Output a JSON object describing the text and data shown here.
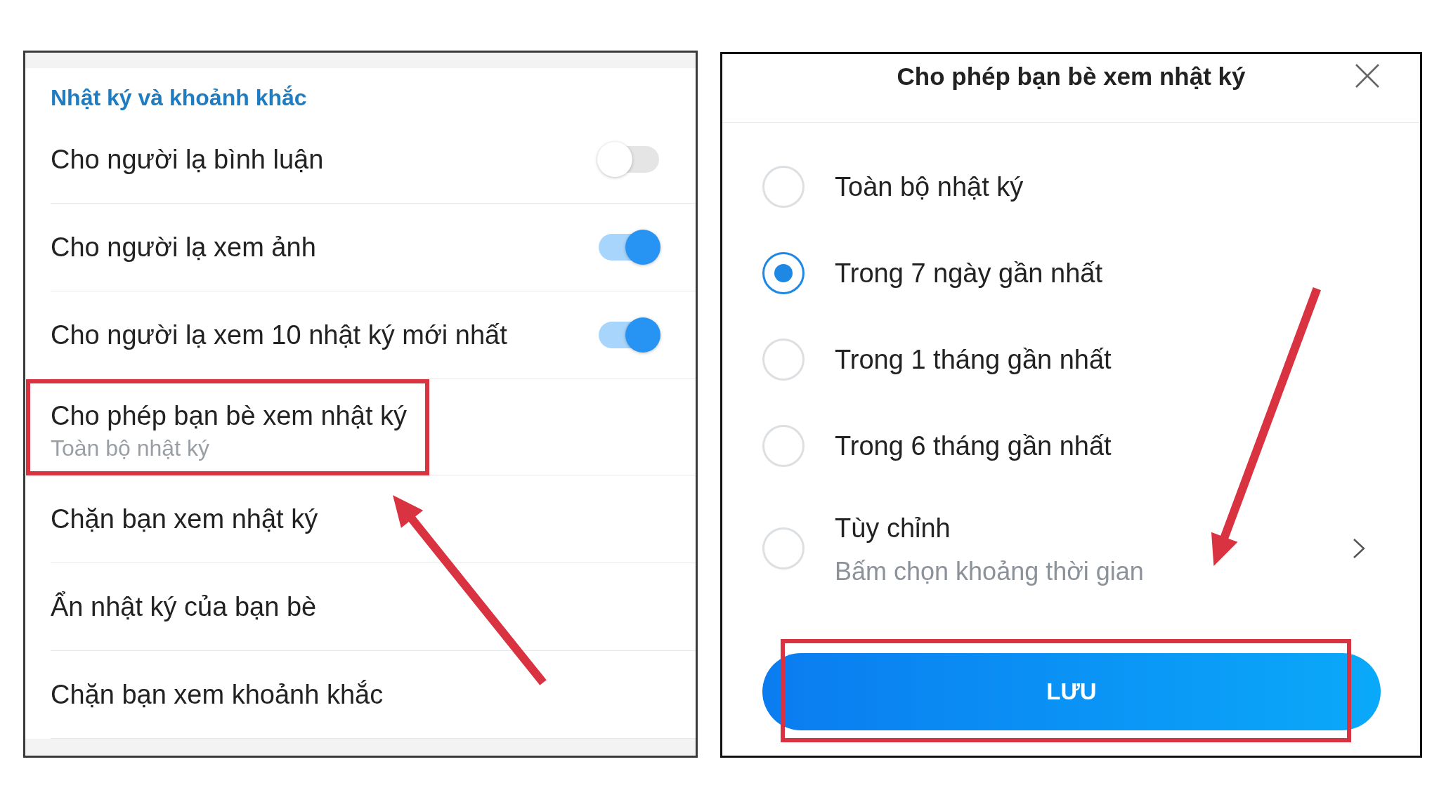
{
  "settings_panel": {
    "section_title": "Nhật ký và khoảnh khắc",
    "items": [
      {
        "kind": "toggle",
        "label": "Cho người lạ bình luận",
        "on": false,
        "highlighted": false
      },
      {
        "kind": "toggle",
        "label": "Cho người lạ xem ảnh",
        "on": true,
        "highlighted": false
      },
      {
        "kind": "toggle",
        "label": "Cho người lạ xem 10 nhật ký mới nhất",
        "on": true,
        "highlighted": false
      },
      {
        "kind": "link",
        "label": "Cho phép bạn bè xem nhật ký",
        "value": "Toàn bộ nhật ký",
        "highlighted": true
      },
      {
        "kind": "link",
        "label": "Chặn bạn xem nhật ký",
        "highlighted": false
      },
      {
        "kind": "link",
        "label": "Ẩn nhật ký của bạn bè",
        "highlighted": false
      },
      {
        "kind": "link",
        "label": "Chặn bạn xem khoảnh khắc",
        "highlighted": false
      }
    ]
  },
  "dialog": {
    "title": "Cho phép bạn bè xem nhật ký",
    "options": [
      {
        "label": "Toàn bộ nhật ký",
        "selected": false,
        "chevron": false
      },
      {
        "label": "Trong 7 ngày gần nhất",
        "selected": true,
        "chevron": false
      },
      {
        "label": "Trong 1 tháng gần nhất",
        "selected": false,
        "chevron": false
      },
      {
        "label": "Trong 6 tháng gần nhất",
        "selected": false,
        "chevron": false
      },
      {
        "label": "Tùy chỉnh",
        "hint": "Bấm chọn khoảng thời gian",
        "selected": false,
        "chevron": true
      }
    ],
    "save_button": {
      "label": "LƯU",
      "highlighted": true
    }
  }
}
